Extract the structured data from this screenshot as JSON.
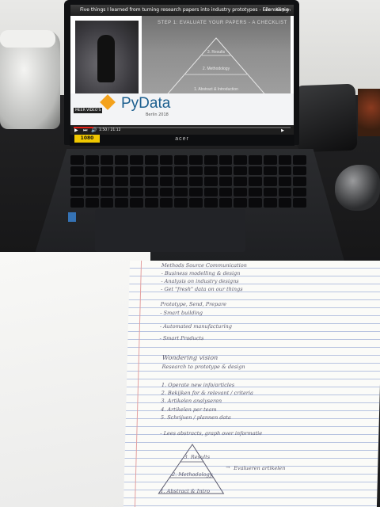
{
  "video": {
    "title": "Five things I learned from turning research papers into industry prototypes - Ellen König",
    "watch_later": "Later bekijken",
    "more_videos": "MEER VIDEO'S",
    "time": "1:50 / 21:12",
    "progress": 0.09
  },
  "slide": {
    "title": "STEP 1: EVALUATE YOUR PAPERS - A CHECKLIST",
    "layers": [
      "3. Results",
      "2. Methodology",
      "1. Abstract & Introduction"
    ]
  },
  "branding": {
    "logo_text": "PyData",
    "subtitle": "Berlin 2018"
  },
  "laptop": {
    "brand": "acer",
    "sticker": "1080"
  },
  "notes": {
    "lines": [
      "Methods Source Communication",
      "- Business modelling & design",
      "- Analysis on industry designs",
      "- Get \"fresh\" data on our things",
      "Prototype, Send, Prepare",
      "- Smart building",
      "- Automated manufacturing",
      "- Smart Products",
      "Wondering vision",
      "Research to prototype & design",
      "1. Operate new info/articles",
      "2. Bekijken for & relevant / criteria",
      "3. Artikelen analyseren",
      "4. Artikelen per team",
      "5. Schrijven / plannen data",
      "- Lees abstracts, graph over informatie",
      "3. Results",
      "2. Methodology",
      "1. Abstract & Intro",
      "Evalueren artikelen"
    ]
  }
}
